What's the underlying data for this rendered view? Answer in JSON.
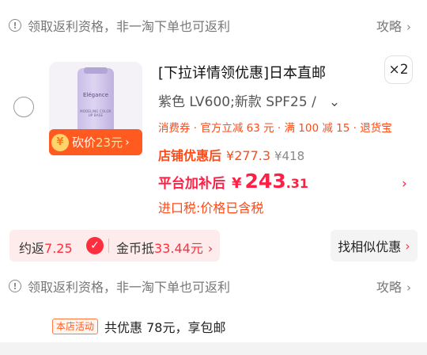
{
  "top_notice": {
    "icon": "info-icon",
    "text": "领取返利资格，非一淘下单也可返利",
    "link": "攻略"
  },
  "product": {
    "image_alt": "Elegance 紫色隔离霜",
    "image_brand": "Elégance",
    "image_small_text": "MODELING COLOR UP BASE",
    "bargain": {
      "label": "砍价",
      "amount": "23元"
    },
    "title": "[下拉详情领优惠]日本直邮",
    "quantity": "×2",
    "sku": "紫色 LV600;新款 SPF25 /",
    "promo": "消费券 · 官方立减 63 元 · 满 100 减 15 · 退货宝",
    "shop_price": {
      "label": "店铺优惠后",
      "currency": "¥",
      "value": "277.3",
      "original": "¥418"
    },
    "final_price": {
      "label": "平台加补后",
      "currency": "¥",
      "integer": "243",
      "decimal": ".31"
    },
    "tax": "进口税:价格已含税"
  },
  "rebate": {
    "label": "约返",
    "value": "7.25",
    "coin_label": "金币抵",
    "coin_value": "33.44元"
  },
  "similar_button": "找相似优惠",
  "bottom_notice": {
    "text": "领取返利资格，非一淘下单也可返利",
    "link": "攻略"
  },
  "store_activity": {
    "badge": "本店活动",
    "text": "共优惠 78元，享包邮"
  },
  "colors": {
    "accent_orange": "#ff4a17",
    "accent_red": "#ff1f44",
    "bargain_bg": "#ff5a1f"
  }
}
